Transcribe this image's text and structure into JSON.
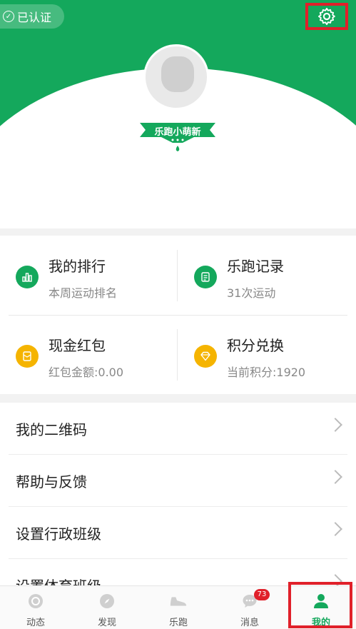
{
  "header": {
    "verified_label": "已认证",
    "rank_badge_label": "乐跑小萌新",
    "nickname_blurred": "",
    "id_blurred": ""
  },
  "grid": [
    {
      "title": "我的排行",
      "subtitle": "本周运动排名",
      "icon": "bar-chart-icon",
      "color": "#14a85c"
    },
    {
      "title": "乐跑记录",
      "subtitle": "31次运动",
      "icon": "document-icon",
      "color": "#14a85c"
    },
    {
      "title": "现金红包",
      "subtitle": "红包金额:0.00",
      "icon": "red-envelope-icon",
      "color": "#f5b400"
    },
    {
      "title": "积分兑换",
      "subtitle": "当前积分:1920",
      "icon": "diamond-icon",
      "color": "#f5b400"
    }
  ],
  "menu": [
    {
      "label": "我的二维码"
    },
    {
      "label": "帮助与反馈"
    },
    {
      "label": "设置行政班级"
    },
    {
      "label": "设置体育班级"
    }
  ],
  "tabbar": {
    "tabs": [
      {
        "label": "动态",
        "icon": "feed-icon"
      },
      {
        "label": "发现",
        "icon": "compass-icon"
      },
      {
        "label": "乐跑",
        "icon": "shoe-icon"
      },
      {
        "label": "消息",
        "icon": "chat-icon",
        "badge": "73"
      },
      {
        "label": "我的",
        "icon": "person-icon"
      }
    ],
    "active": "我的"
  },
  "colors": {
    "brand_green": "#14a85c",
    "highlight_red": "#e0202a",
    "gold": "#f5b400"
  }
}
